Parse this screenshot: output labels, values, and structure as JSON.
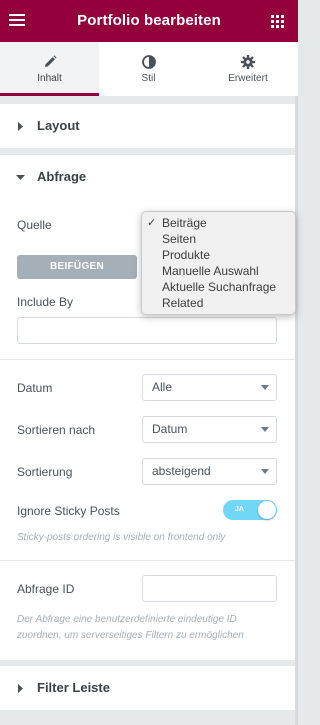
{
  "header": {
    "title": "Portfolio bearbeiten",
    "menu_icon": "hamburger-icon",
    "apps_icon": "grid-icon",
    "color": "#93003c"
  },
  "tabs": [
    {
      "label": "Inhalt",
      "icon": "pencil-icon",
      "active": true
    },
    {
      "label": "Stil",
      "icon": "contrast-icon",
      "active": false
    },
    {
      "label": "Erweitert",
      "icon": "gear-icon",
      "active": false
    }
  ],
  "sections": {
    "layout": {
      "title": "Layout",
      "expanded": false
    },
    "abfrage": {
      "title": "Abfrage",
      "expanded": true
    },
    "filter": {
      "title": "Filter Leiste",
      "expanded": false
    }
  },
  "query": {
    "quelle_label": "Quelle",
    "add_button": "BEIFÜGEN",
    "include_by_label": "Include By",
    "include_by_value": "",
    "datum_label": "Datum",
    "datum_value": "Alle",
    "sort_by_label": "Sortieren nach",
    "sort_by_value": "Datum",
    "order_label": "Sortierung",
    "order_value": "absteigend",
    "sticky_label": "Ignore Sticky Posts",
    "sticky_toggle_label": "JA",
    "sticky_enabled": true,
    "sticky_note": "Sticky-posts ordering is visible on frontend only",
    "query_id_label": "Abfrage ID",
    "query_id_value": "",
    "query_id_note": "Der Abfrage eine benutzerdefinierte eindeutige ID zuordnen, um serverseitiges Filtern zu ermöglichen"
  },
  "source_dropdown": {
    "selected": "Beiträge",
    "check_mark": "✓",
    "options": [
      "Beiträge",
      "Seiten",
      "Produkte",
      "Manuelle Auswahl",
      "Aktuelle Suchanfrage",
      "Related"
    ]
  }
}
